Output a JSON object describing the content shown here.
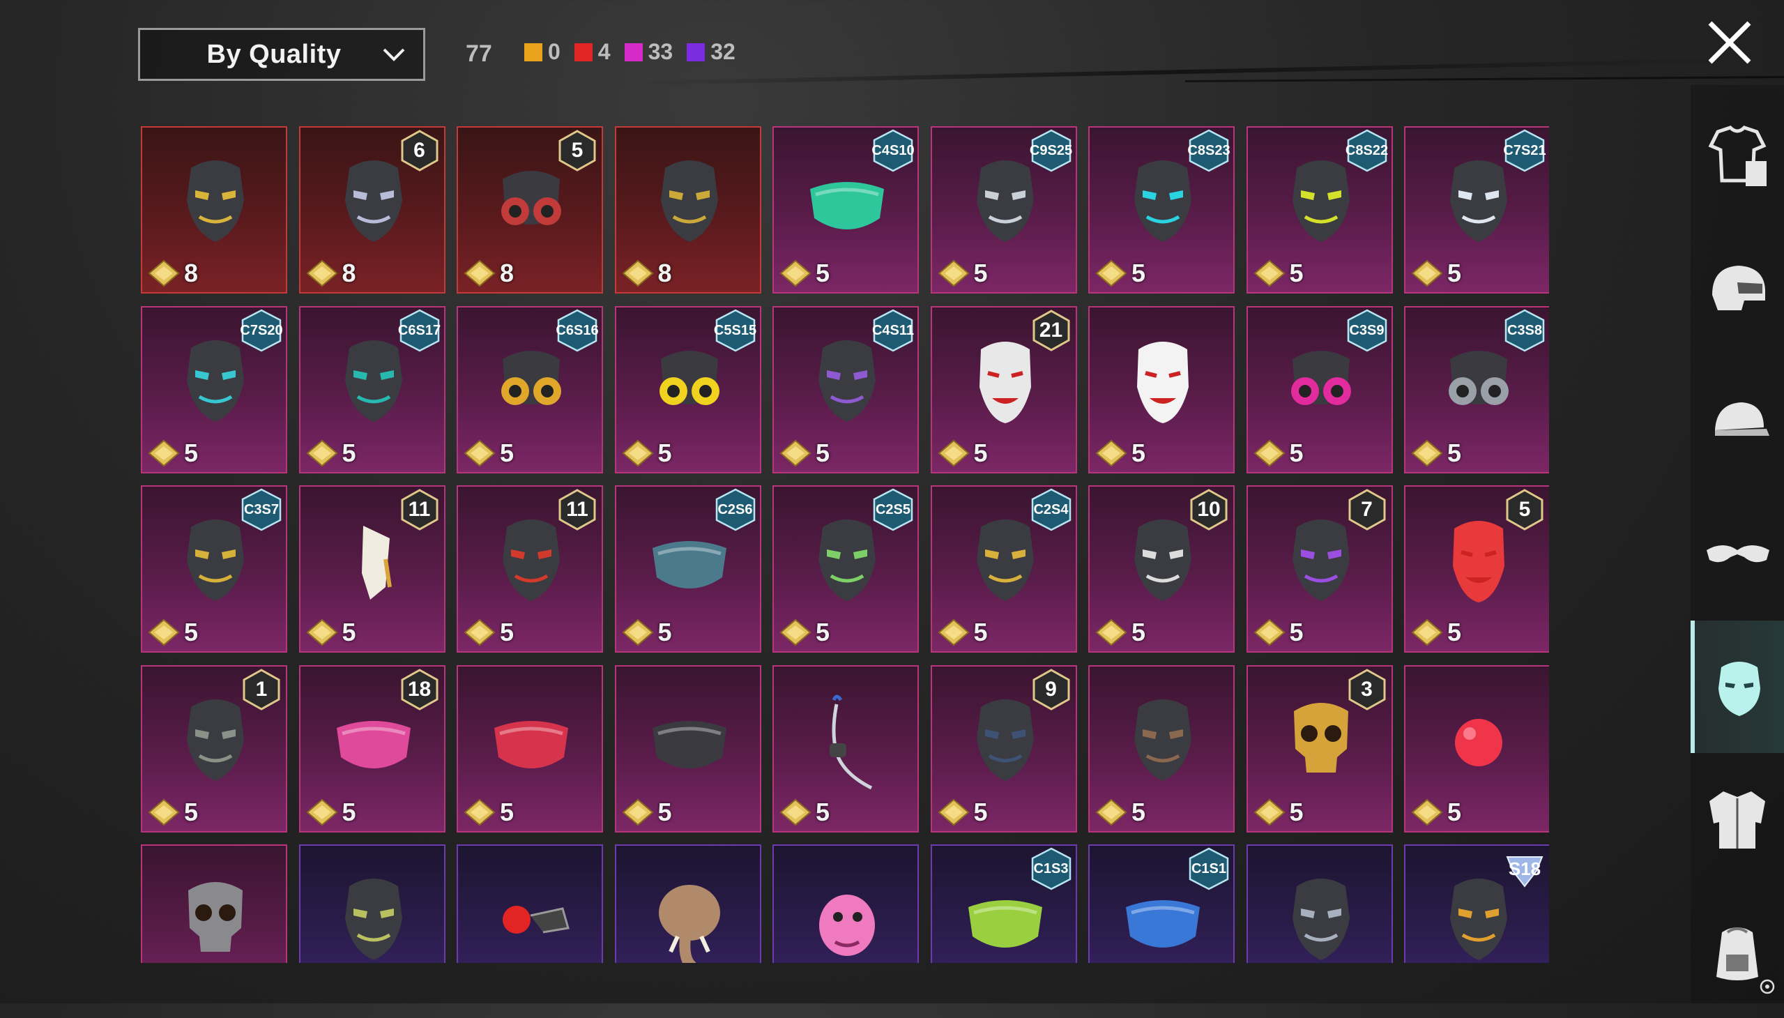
{
  "header": {
    "sort_label": "By Quality",
    "total_count": "77",
    "quality_counts": [
      {
        "color": "#e8a21c",
        "value": "0"
      },
      {
        "color": "#e32424",
        "value": "4"
      },
      {
        "color": "#d42bc9",
        "value": "33"
      },
      {
        "color": "#7b2be0",
        "value": "32"
      }
    ],
    "close_icon": "close-icon"
  },
  "sidebar": {
    "categories": [
      {
        "icon": "outfit-icon",
        "active": false
      },
      {
        "icon": "helmet-icon",
        "active": false
      },
      {
        "icon": "cap-icon",
        "active": false
      },
      {
        "icon": "glasses-icon",
        "active": false
      },
      {
        "icon": "mask-icon",
        "active": true
      },
      {
        "icon": "jacket-icon",
        "active": false
      },
      {
        "icon": "backpack-icon",
        "active": false
      }
    ]
  },
  "items": [
    {
      "quality": "red",
      "price": "8",
      "badge": "",
      "icon": "tactical-helmet-mask-icon",
      "accent": "#d9b43a"
    },
    {
      "quality": "red",
      "price": "8",
      "badge": "6",
      "icon": "plague-beak-mask-icon",
      "accent": "#b8bcd8"
    },
    {
      "quality": "red",
      "price": "8",
      "badge": "5",
      "icon": "cyber-gas-mask-icon",
      "accent": "#c23b3b"
    },
    {
      "quality": "red",
      "price": "8",
      "badge": "",
      "icon": "dark-beast-mask-icon",
      "accent": "#caa93a"
    },
    {
      "quality": "magenta",
      "price": "5",
      "badge": "C4S10",
      "icon": "green-face-mask-icon",
      "accent": "#2ec79c"
    },
    {
      "quality": "magenta",
      "price": "5",
      "badge": "C9S25",
      "icon": "silver-winged-mask-icon",
      "accent": "#c9d0d8"
    },
    {
      "quality": "magenta",
      "price": "5",
      "badge": "C8S23",
      "icon": "cyan-neon-mask-icon",
      "accent": "#29d3e0"
    },
    {
      "quality": "magenta",
      "price": "5",
      "badge": "C8S22",
      "icon": "black-neon-ring-mask-icon",
      "accent": "#d4e12a"
    },
    {
      "quality": "magenta",
      "price": "5",
      "badge": "C7S21",
      "icon": "white-tech-mask-icon",
      "accent": "#e0e6f0"
    },
    {
      "quality": "magenta",
      "price": "5",
      "badge": "C7S20",
      "icon": "black-cyan-mask-icon",
      "accent": "#38c6d0"
    },
    {
      "quality": "magenta",
      "price": "5",
      "badge": "C6S17",
      "icon": "teal-graffiti-mask-icon",
      "accent": "#27b8b0"
    },
    {
      "quality": "magenta",
      "price": "5",
      "badge": "C6S16",
      "icon": "orange-gas-mask-icon",
      "accent": "#e0a72a"
    },
    {
      "quality": "magenta",
      "price": "5",
      "badge": "C5S15",
      "icon": "yellow-respirator-icon",
      "accent": "#f0d21f"
    },
    {
      "quality": "magenta",
      "price": "5",
      "badge": "C4S11",
      "icon": "purple-visor-mask-icon",
      "accent": "#8e5ad0"
    },
    {
      "quality": "magenta",
      "price": "5",
      "badge": "21",
      "icon": "joker-mask-icon",
      "accent": "#e8e8e8"
    },
    {
      "quality": "magenta",
      "price": "5",
      "badge": "",
      "icon": "kitsune-mask-icon",
      "accent": "#f3f3f3"
    },
    {
      "quality": "magenta",
      "price": "5",
      "badge": "C3S9",
      "icon": "pink-spiked-gas-mask-icon",
      "accent": "#e22c9e"
    },
    {
      "quality": "magenta",
      "price": "5",
      "badge": "C3S8",
      "icon": "grey-respirator-icon",
      "accent": "#9aa0a8"
    },
    {
      "quality": "magenta",
      "price": "5",
      "badge": "C3S7",
      "icon": "gold-chain-mask-icon",
      "accent": "#d6b13a"
    },
    {
      "quality": "magenta",
      "price": "5",
      "badge": "11",
      "icon": "crystal-shard-mask-icon",
      "accent": "#f1ece0"
    },
    {
      "quality": "magenta",
      "price": "5",
      "badge": "11",
      "icon": "red-oni-mask-icon",
      "accent": "#d23a2c"
    },
    {
      "quality": "magenta",
      "price": "5",
      "badge": "C2S6",
      "icon": "tribal-face-mask-icon",
      "accent": "#4b7a8c"
    },
    {
      "quality": "magenta",
      "price": "5",
      "badge": "C2S5",
      "icon": "snake-scale-mask-icon",
      "accent": "#7dd067"
    },
    {
      "quality": "magenta",
      "price": "5",
      "badge": "C2S4",
      "icon": "gold-mech-mask-icon",
      "accent": "#d8b13c"
    },
    {
      "quality": "magenta",
      "price": "5",
      "badge": "10",
      "icon": "white-robot-mask-icon",
      "accent": "#dcdcdc"
    },
    {
      "quality": "magenta",
      "price": "5",
      "badge": "7",
      "icon": "gold-purple-demon-mask-icon",
      "accent": "#9a4fe0"
    },
    {
      "quality": "magenta",
      "price": "5",
      "badge": "5",
      "icon": "clown-mask-icon",
      "accent": "#e83a3a"
    },
    {
      "quality": "magenta",
      "price": "5",
      "badge": "1",
      "icon": "steel-helmet-mask-icon",
      "accent": "#8a9288"
    },
    {
      "quality": "magenta",
      "price": "5",
      "badge": "18",
      "icon": "pink-cloth-mask-icon",
      "accent": "#e04a9a"
    },
    {
      "quality": "magenta",
      "price": "5",
      "badge": "",
      "icon": "red-bandana-icon",
      "accent": "#d6344c"
    },
    {
      "quality": "magenta",
      "price": "5",
      "badge": "",
      "icon": "black-bandana-icon",
      "accent": "#3a3a40"
    },
    {
      "quality": "magenta",
      "price": "5",
      "badge": "",
      "icon": "headset-mic-icon",
      "accent": "#cfd4dc"
    },
    {
      "quality": "magenta",
      "price": "5",
      "badge": "9",
      "icon": "navy-samurai-mask-icon",
      "accent": "#3d5275"
    },
    {
      "quality": "magenta",
      "price": "5",
      "badge": "",
      "icon": "brown-beak-mask-icon",
      "accent": "#8a6850"
    },
    {
      "quality": "magenta",
      "price": "5",
      "badge": "3",
      "icon": "golden-skull-mask-icon",
      "accent": "#d6a23a"
    },
    {
      "quality": "magenta",
      "price": "5",
      "badge": "",
      "icon": "red-clown-nose-icon",
      "accent": "#f0354a"
    },
    {
      "quality": "magenta",
      "price": "",
      "badge": "",
      "icon": "skull-scarf-mask-icon",
      "accent": "#8a8a8e"
    },
    {
      "quality": "purple",
      "price": "",
      "badge": "",
      "icon": "hockey-mask-icon",
      "accent": "#b8c060"
    },
    {
      "quality": "purple",
      "price": "",
      "badge": "",
      "icon": "red-eye-device-icon",
      "accent": "#e32424"
    },
    {
      "quality": "purple",
      "price": "",
      "badge": "",
      "icon": "elephant-mask-icon",
      "accent": "#b08a6a"
    },
    {
      "quality": "purple",
      "price": "",
      "badge": "",
      "icon": "pink-dino-mask-icon",
      "accent": "#f07ac0"
    },
    {
      "quality": "purple",
      "price": "",
      "badge": "C1S3",
      "icon": "cactus-face-mask-icon",
      "accent": "#9ad040"
    },
    {
      "quality": "purple",
      "price": "",
      "badge": "C1S1",
      "icon": "blue-white-mask-icon",
      "accent": "#3a78d8"
    },
    {
      "quality": "purple",
      "price": "",
      "badge": "",
      "icon": "silver-half-mask-icon",
      "accent": "#a8b0c0"
    },
    {
      "quality": "purple",
      "price": "",
      "badge": "S18",
      "icon": "heartbeat-mask-icon",
      "accent": "#e0a030"
    }
  ]
}
